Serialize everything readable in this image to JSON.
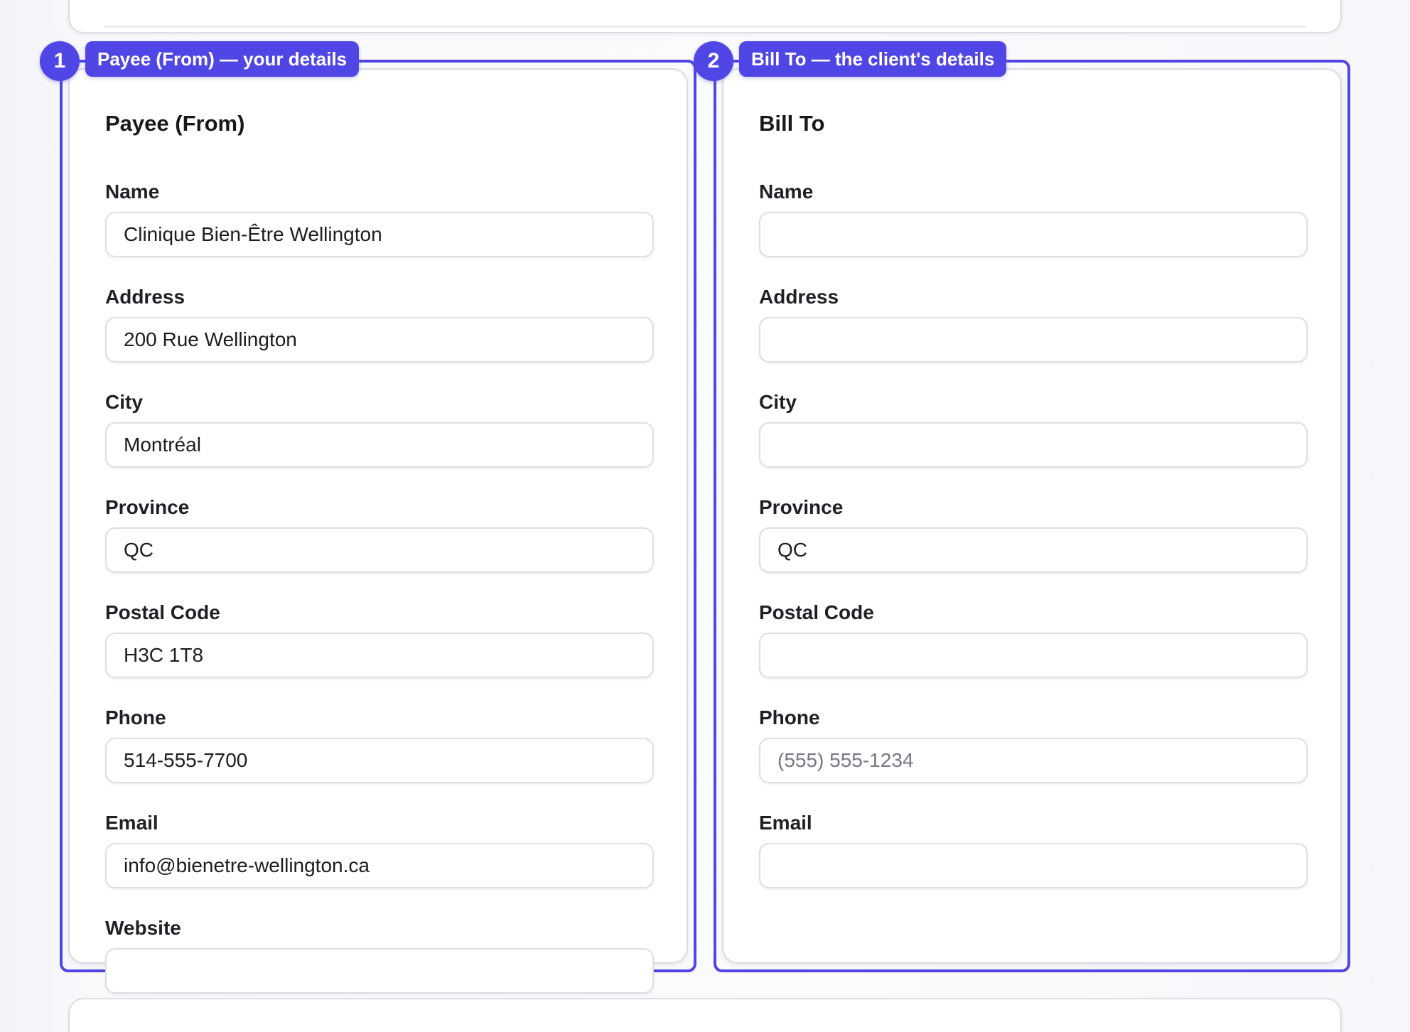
{
  "steps": [
    {
      "number": "1",
      "label": "Payee (From) — your details"
    },
    {
      "number": "2",
      "label": "Bill To — the client's details"
    }
  ],
  "payee": {
    "title": "Payee (From)",
    "fields": {
      "name": {
        "label": "Name",
        "value": "Clinique Bien-Être Wellington"
      },
      "address": {
        "label": "Address",
        "value": "200 Rue Wellington"
      },
      "city": {
        "label": "City",
        "value": "Montréal"
      },
      "province": {
        "label": "Province",
        "value": "QC"
      },
      "postal_code": {
        "label": "Postal Code",
        "value": "H3C 1T8"
      },
      "phone": {
        "label": "Phone",
        "value": "514-555-7700"
      },
      "email": {
        "label": "Email",
        "value": "info@bienetre-wellington.ca"
      },
      "website": {
        "label": "Website",
        "value": ""
      }
    }
  },
  "bill_to": {
    "title": "Bill To",
    "fields": {
      "name": {
        "label": "Name",
        "value": ""
      },
      "address": {
        "label": "Address",
        "value": ""
      },
      "city": {
        "label": "City",
        "value": ""
      },
      "province": {
        "label": "Province",
        "value": "QC"
      },
      "postal_code": {
        "label": "Postal Code",
        "value": ""
      },
      "phone": {
        "label": "Phone",
        "value": "",
        "placeholder": "(555) 555-1234"
      },
      "email": {
        "label": "Email",
        "value": ""
      }
    }
  },
  "colors": {
    "accent": "#4f46e5",
    "card_border": "#dadae0",
    "background": "#f8f8fb"
  }
}
